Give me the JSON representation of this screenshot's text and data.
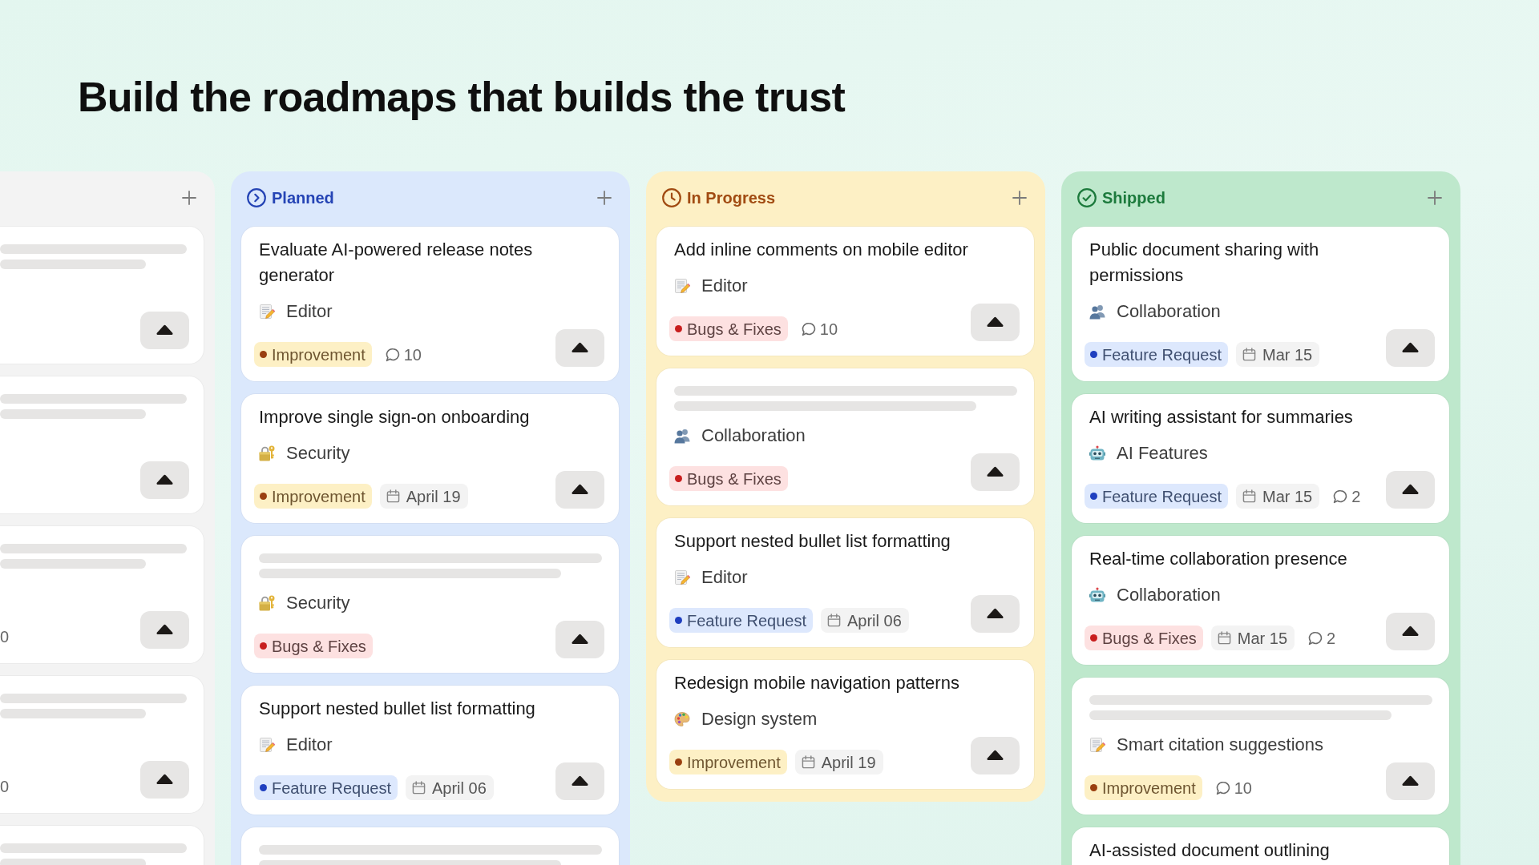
{
  "heading": "Build the roadmaps that builds the trust",
  "columns": [
    {
      "kind": "neutral",
      "cards": [
        {
          "kind": "skeleton"
        },
        {
          "kind": "skeleton"
        },
        {
          "kind": "skeleton",
          "comments": "0"
        },
        {
          "kind": "skeleton",
          "comments": "0"
        },
        {
          "kind": "skeleton"
        }
      ]
    },
    {
      "kind": "planned",
      "title": "Planned",
      "cards": [
        {
          "kind": "task",
          "title": "Evaluate AI-powered release notes generator",
          "category": {
            "label": "Editor",
            "kind": "memo"
          },
          "tag": {
            "label": "Improvement",
            "color": "#9a3f10"
          },
          "comments": "10"
        },
        {
          "kind": "task",
          "title": "Improve single sign-on onboarding",
          "category": {
            "label": "Security",
            "kind": "lock"
          },
          "tag": {
            "label": "Improvement",
            "color": "#9a3f10"
          },
          "date": "April 19"
        },
        {
          "kind": "skeleton",
          "category": {
            "label": "Security",
            "kind": "lock"
          },
          "tag": {
            "label": "Bugs & Fixes",
            "color": "#c81e1e"
          }
        },
        {
          "kind": "task",
          "title": "Support nested bullet list formatting",
          "category": {
            "label": "Editor",
            "kind": "memo"
          },
          "tag": {
            "label": "Feature Request",
            "color": "#1f3fbf"
          },
          "date": "April 06"
        },
        {
          "kind": "skeleton"
        }
      ]
    },
    {
      "kind": "progress",
      "title": "In Progress",
      "cards": [
        {
          "kind": "task",
          "title": "Add inline comments on mobile editor",
          "category": {
            "label": "Editor",
            "kind": "memo"
          },
          "tag": {
            "label": "Bugs & Fixes",
            "color": "#c81e1e"
          },
          "comments": "10"
        },
        {
          "kind": "skeleton",
          "category": {
            "label": "Collaboration",
            "kind": "people"
          },
          "tag": {
            "label": "Bugs & Fixes",
            "color": "#c81e1e"
          }
        },
        {
          "kind": "task",
          "title": "Support nested bullet list formatting",
          "category": {
            "label": "Editor",
            "kind": "memo"
          },
          "tag": {
            "label": "Feature Request",
            "color": "#1f3fbf"
          },
          "date": "April 06"
        },
        {
          "kind": "task",
          "title": "Redesign mobile navigation patterns",
          "category": {
            "label": "Design system",
            "kind": "palette"
          },
          "tag": {
            "label": "Improvement",
            "color": "#9a3f10"
          },
          "date": "April 19"
        }
      ]
    },
    {
      "kind": "shipped",
      "title": "Shipped",
      "cards": [
        {
          "kind": "task",
          "title": "Public document sharing with permissions",
          "category": {
            "label": "Collaboration",
            "kind": "people"
          },
          "tag": {
            "label": "Feature Request",
            "color": "#1f3fbf"
          },
          "date": "Mar 15"
        },
        {
          "kind": "task",
          "title": "AI writing assistant for summaries",
          "category": {
            "label": "AI Features",
            "kind": "robot"
          },
          "tag": {
            "label": "Feature Request",
            "color": "#1f3fbf"
          },
          "date": "Mar 15",
          "comments": "2"
        },
        {
          "kind": "task",
          "title": "Real-time collaboration presence",
          "category": {
            "label": "Collaboration",
            "kind": "robot"
          },
          "tag": {
            "label": "Bugs & Fixes",
            "color": "#c81e1e"
          },
          "date": "Mar 15",
          "comments": "2"
        },
        {
          "kind": "skeleton",
          "category": {
            "label": "Smart citation suggestions",
            "kind": "memo"
          },
          "tag": {
            "label": "Improvement",
            "color": "#9a3f10"
          },
          "comments": "10"
        },
        {
          "kind": "task",
          "title": "AI-assisted document outlining"
        }
      ]
    }
  ]
}
